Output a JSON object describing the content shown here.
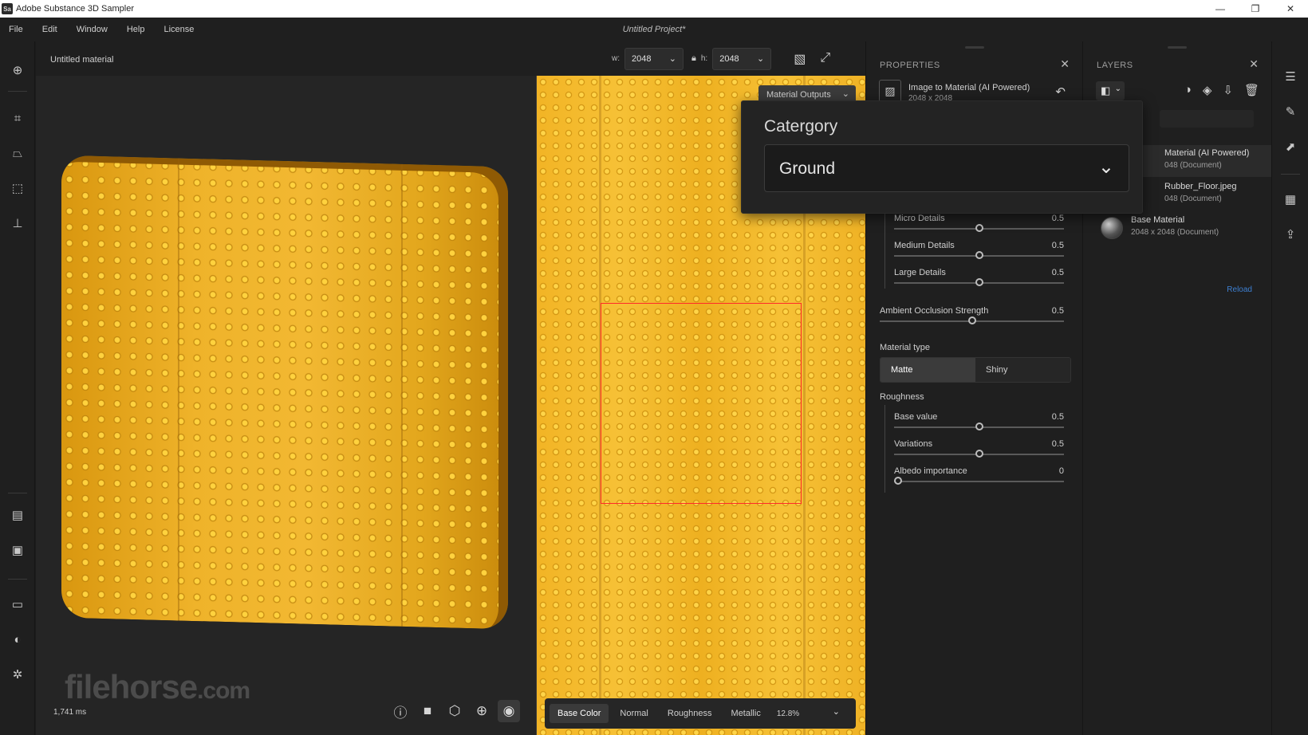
{
  "window": {
    "app_icon_text": "Sa",
    "title": "Adobe Substance 3D Sampler",
    "controls": [
      "—",
      "❐",
      "✕"
    ]
  },
  "menubar": {
    "items": [
      "File",
      "Edit",
      "Window",
      "Help",
      "License"
    ],
    "project_title": "Untitled Project*"
  },
  "viewport": {
    "material_name": "Untitled material",
    "timing": "1,741 ms",
    "watermark_main": "filehorse",
    "watermark_suffix": ".com"
  },
  "dims": {
    "w_label": "w:",
    "w_value": "2048",
    "h_label": "h:",
    "h_value": "2048"
  },
  "view2d": {
    "material_outputs_label": "Material Outputs",
    "channels": [
      "Base Color",
      "Normal",
      "Roughness",
      "Metallic"
    ],
    "active_channel": "Base Color",
    "zoom": "12.8%"
  },
  "category_popup": {
    "label": "Catergory",
    "value": "Ground"
  },
  "properties": {
    "title": "PROPERTIES",
    "layer_name": "Image to Material (AI Powered)",
    "layer_size": "2048 x 2048",
    "sliders": [
      {
        "label": "Micro Details",
        "value": "0.5",
        "fraction": 0.5
      },
      {
        "label": "Medium Details",
        "value": "0.5",
        "fraction": 0.5
      },
      {
        "label": "Large Details",
        "value": "0.5",
        "fraction": 0.5
      }
    ],
    "ao": {
      "label": "Ambient Occlusion Strength",
      "value": "0.5",
      "fraction": 0.5
    },
    "material_type": {
      "label": "Material type",
      "options": [
        "Matte",
        "Shiny"
      ],
      "selected": "Matte"
    },
    "roughness": {
      "label": "Roughness",
      "sliders": [
        {
          "label": "Base value",
          "value": "0.5",
          "fraction": 0.5
        },
        {
          "label": "Variations",
          "value": "0.5",
          "fraction": 0.5
        },
        {
          "label": "Albedo importance",
          "value": "0",
          "fraction": 0
        }
      ]
    }
  },
  "layers": {
    "title": "LAYERS",
    "items": [
      {
        "name": "Material (AI Powered)",
        "size": "048 (Document)",
        "selected": true
      },
      {
        "name": "Rubber_Floor.jpeg",
        "size": "048 (Document)",
        "selected": false
      },
      {
        "name": "Base Material",
        "size": "2048 x 2048 (Document)",
        "selected": false
      }
    ],
    "reload": "Reload"
  },
  "colors": {
    "accent_blue": "#3d7fd1",
    "crop_red": "#ff2a2a",
    "material_orange": "#f2b425"
  }
}
